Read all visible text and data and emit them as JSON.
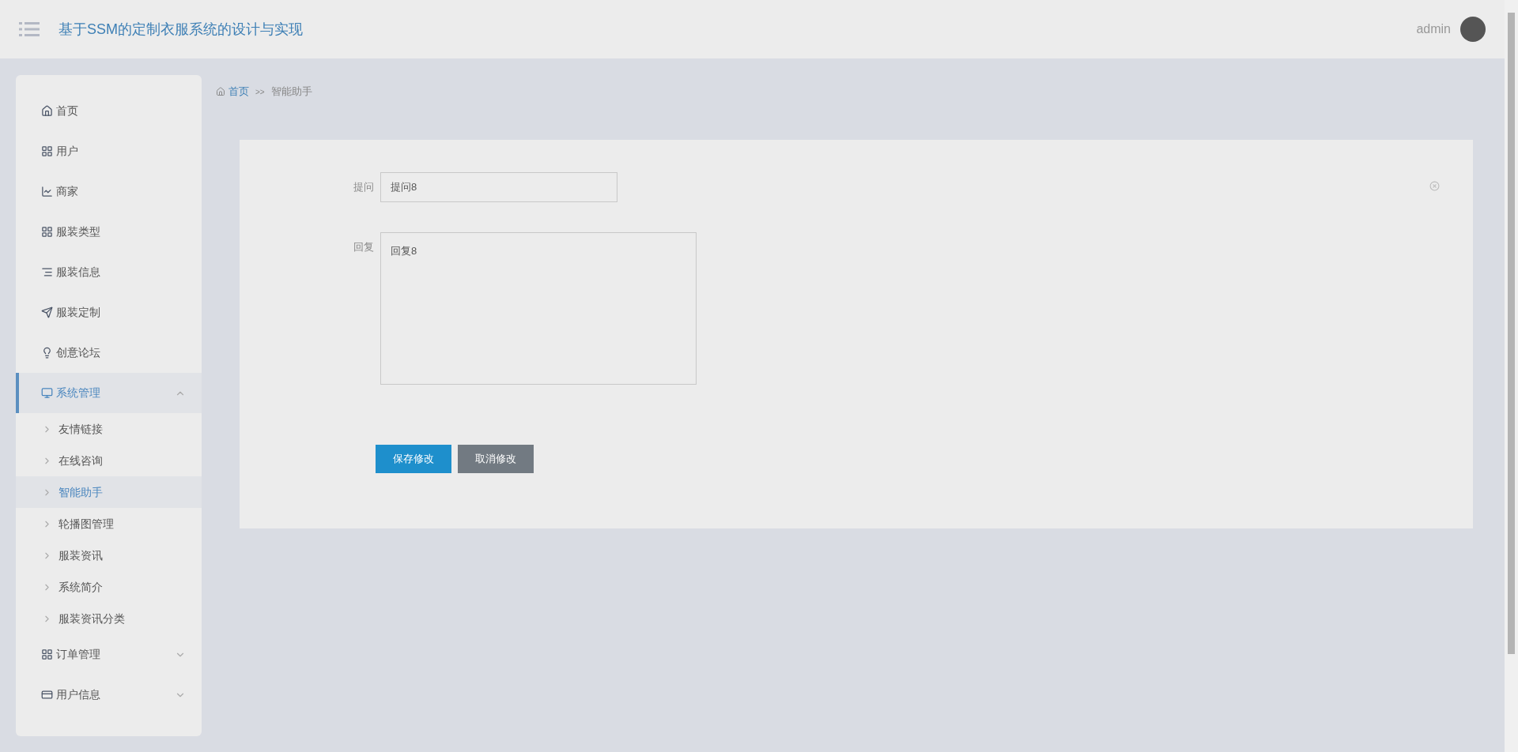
{
  "header": {
    "title": "基于SSM的定制衣服系统的设计与实现",
    "user": "admin"
  },
  "sidebar": {
    "items": [
      {
        "label": "首页",
        "selected": false
      },
      {
        "label": "用户",
        "selected": false
      },
      {
        "label": "商家",
        "selected": false
      },
      {
        "label": "服装类型",
        "selected": false
      },
      {
        "label": "服装信息",
        "selected": false
      },
      {
        "label": "服装定制",
        "selected": false
      },
      {
        "label": "创意论坛",
        "selected": false
      },
      {
        "label": "系统管理",
        "selected": true,
        "expanded": true,
        "children": [
          {
            "label": "友情链接",
            "selected": false
          },
          {
            "label": "在线咨询",
            "selected": false
          },
          {
            "label": "智能助手",
            "selected": true
          },
          {
            "label": "轮播图管理",
            "selected": false
          },
          {
            "label": "服装资讯",
            "selected": false
          },
          {
            "label": "系统简介",
            "selected": false
          },
          {
            "label": "服装资讯分类",
            "selected": false
          }
        ]
      },
      {
        "label": "订单管理",
        "selected": false,
        "expanded": false
      },
      {
        "label": "用户信息",
        "selected": false,
        "expanded": false
      }
    ]
  },
  "breadcrumb": {
    "home": "首页",
    "separator": ">>",
    "current": "智能助手"
  },
  "form": {
    "fields": [
      {
        "kind": "input",
        "label": "提问",
        "value": "提问8"
      },
      {
        "kind": "textarea",
        "label": "回复",
        "value": "回复8"
      }
    ],
    "buttons": [
      {
        "kind": "primary",
        "label": "保存修改"
      },
      {
        "kind": "secondary",
        "label": "取消修改"
      }
    ]
  }
}
